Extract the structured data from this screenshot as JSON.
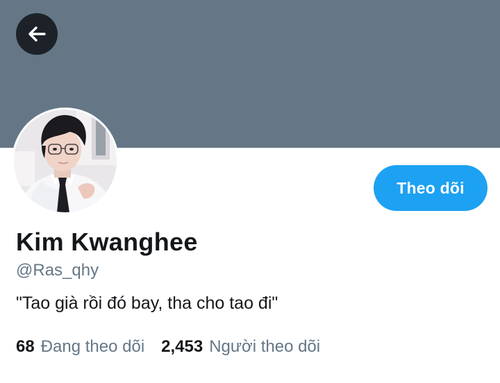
{
  "profile": {
    "name": "Kim Kwanghee",
    "handle": "@Ras_qhy",
    "bio": "\"Tao già rồi đó bay, tha cho tao đi\"",
    "follow_label": "Theo dõi"
  },
  "stats": {
    "following_count": "68",
    "following_label": "Đang theo dõi",
    "followers_count": "2,453",
    "followers_label": "Người theo dõi"
  },
  "icons": {
    "back": "back-arrow-icon"
  },
  "colors": {
    "banner": "#657786",
    "accent": "#1da1f2",
    "text_primary": "#14171a",
    "text_secondary": "#657786"
  }
}
